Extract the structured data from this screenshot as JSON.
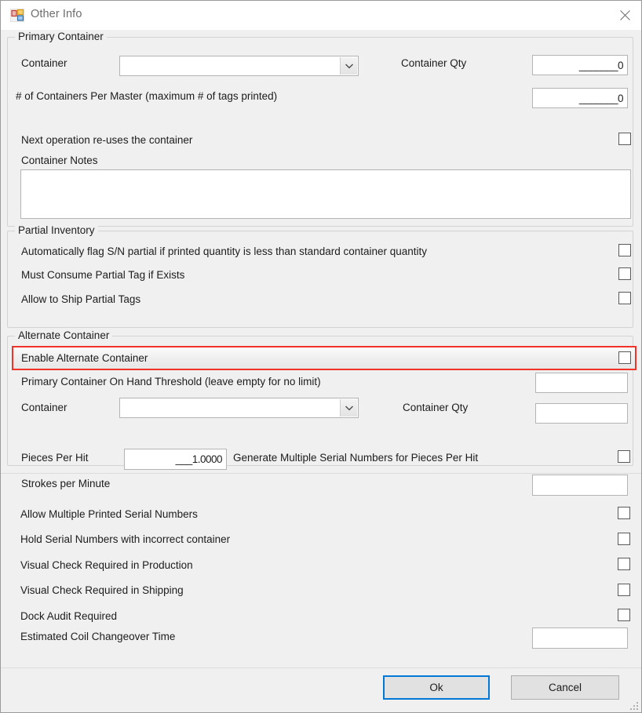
{
  "window": {
    "title": "Other Info",
    "icon": "windows-form-icon",
    "close_icon": "close-icon"
  },
  "groups": {
    "primary_container": {
      "title": "Primary Container",
      "container_label": "Container",
      "container_value": "",
      "container_qty_label": "Container Qty",
      "container_qty_value": "_______0",
      "per_master_label": "# of Containers Per Master (maximum # of tags printed)",
      "per_master_value": "_______0",
      "reuse_label": "Next operation re-uses the container",
      "reuse_checked": false,
      "notes_label": "Container Notes",
      "notes_value": ""
    },
    "partial_inventory": {
      "title": "Partial Inventory",
      "rows": [
        {
          "label": "Automatically flag S/N partial if printed quantity is less than standard container quantity",
          "checked": false
        },
        {
          "label": "Must Consume Partial Tag if Exists",
          "checked": false
        },
        {
          "label": "Allow to Ship Partial Tags",
          "checked": false
        }
      ]
    },
    "alternate_container": {
      "title": "Alternate Container",
      "enable_label": "Enable Alternate Container",
      "enable_checked": false,
      "highlight_color": "#f2332a",
      "threshold_label": "Primary Container On Hand Threshold (leave empty for no limit)",
      "threshold_value": "",
      "container_label": "Container",
      "container_value": "",
      "container_qty_label": "Container Qty",
      "container_qty_value": ""
    }
  },
  "misc": {
    "pieces_per_hit_label": "Pieces Per Hit",
    "pieces_per_hit_value": "___1.0000",
    "generate_multiple_label": "Generate Multiple Serial Numbers for Pieces Per Hit",
    "generate_multiple_checked": false,
    "strokes_label": "Strokes per Minute",
    "strokes_value": "",
    "rows": [
      {
        "label": "Allow Multiple Printed Serial Numbers",
        "checked": false
      },
      {
        "label": "Hold Serial Numbers with incorrect container",
        "checked": false
      },
      {
        "label": "Visual Check Required in Production",
        "checked": false
      },
      {
        "label": "Visual Check Required in Shipping",
        "checked": false
      },
      {
        "label": "Dock Audit Required",
        "checked": false
      }
    ],
    "coil_label": "Estimated Coil Changeover Time",
    "coil_value": ""
  },
  "footer": {
    "ok_label": "Ok",
    "cancel_label": "Cancel"
  }
}
